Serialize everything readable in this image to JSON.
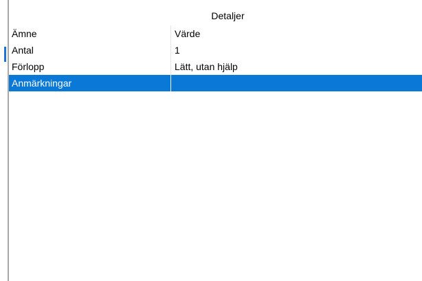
{
  "panel": {
    "title": "Detaljer"
  },
  "table": {
    "headers": {
      "key": "Ämne",
      "value": "Värde"
    },
    "rows": [
      {
        "key": "Antal",
        "value": "1"
      },
      {
        "key": "Förlopp",
        "value": "Lätt, utan hjälp"
      },
      {
        "key": "Anmärkningar",
        "value": ""
      }
    ],
    "selected_row": 2
  },
  "colors": {
    "selection": "#0a78d7",
    "accent": "#1e73d8"
  }
}
